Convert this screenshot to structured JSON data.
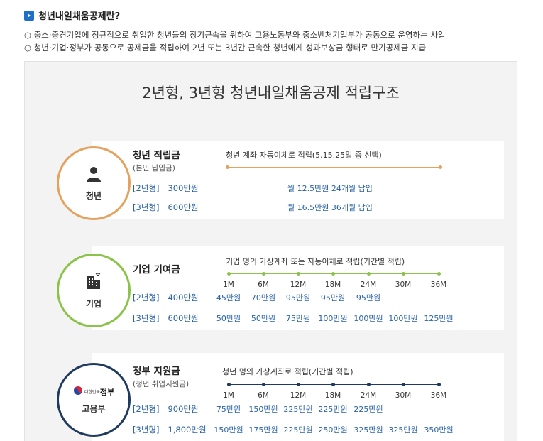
{
  "header": {
    "title": "청년내일채움공제란?"
  },
  "intro": [
    "○ 중소·중견기업에 정규직으로 취업한 청년들의 장기근속을 위하여 고용노동부와 중소벤처기업부가 공동으로 운영하는 사업",
    "○ 청년·기업·정부가 공동으로 공제금을 적립하여 2년 또는 3년간 근속한 청년에게 성과보상금 형태로 만기공제금 지급"
  ],
  "panel_title": "2년형, 3년형 청년내일채움공제 적립구조",
  "youth": {
    "circle_label": "청년",
    "title": "청년 적립금",
    "subtitle": "(본인 납입금)",
    "desc": "청년 계좌 자동이체로 적립(5,15,25일 중 선택)",
    "color": "#e3a35f",
    "rows": [
      {
        "type": "[2년형]",
        "amount": "300만원",
        "note": "월 12.5만원 24개월 납입"
      },
      {
        "type": "[3년형]",
        "amount": "600만원",
        "note": "월 16.5만원 36개월 납입"
      }
    ]
  },
  "company": {
    "circle_label": "기업",
    "title": "기업 기여금",
    "desc": "기업 명의 가상계좌 또는 자동이체로 적립(기간별 적립)",
    "color": "#8bc34a",
    "months": [
      "1M",
      "6M",
      "12M",
      "18M",
      "24M",
      "30M",
      "36M"
    ],
    "rows": [
      {
        "type": "[2년형]",
        "amount": "400만원",
        "values": [
          "45만원",
          "70만원",
          "95만원",
          "95만원",
          "95만원"
        ]
      },
      {
        "type": "[3년형]",
        "amount": "600만원",
        "values": [
          "50만원",
          "50만원",
          "75만원",
          "100만원",
          "100만원",
          "100만원",
          "125만원"
        ]
      }
    ]
  },
  "government": {
    "circle_label": "고용부",
    "logo_small": "대한민국",
    "logo_big": "정부",
    "title": "정부 지원금",
    "subtitle": "(청년 취업지원금)",
    "desc": "청년 명의 가상계좌로 적립(기간별 적립)",
    "color": "#1f3a5f",
    "months": [
      "1M",
      "6M",
      "12M",
      "18M",
      "24M",
      "30M",
      "36M"
    ],
    "rows": [
      {
        "type": "[2년형]",
        "amount": "900만원",
        "values": [
          "75만원",
          "150만원",
          "225만원",
          "225만원",
          "225만원"
        ]
      },
      {
        "type": "[3년형]",
        "amount": "1,800만원",
        "values": [
          "150만원",
          "175만원",
          "225만원",
          "250만원",
          "325만원",
          "325만원",
          "350만원"
        ]
      }
    ]
  }
}
